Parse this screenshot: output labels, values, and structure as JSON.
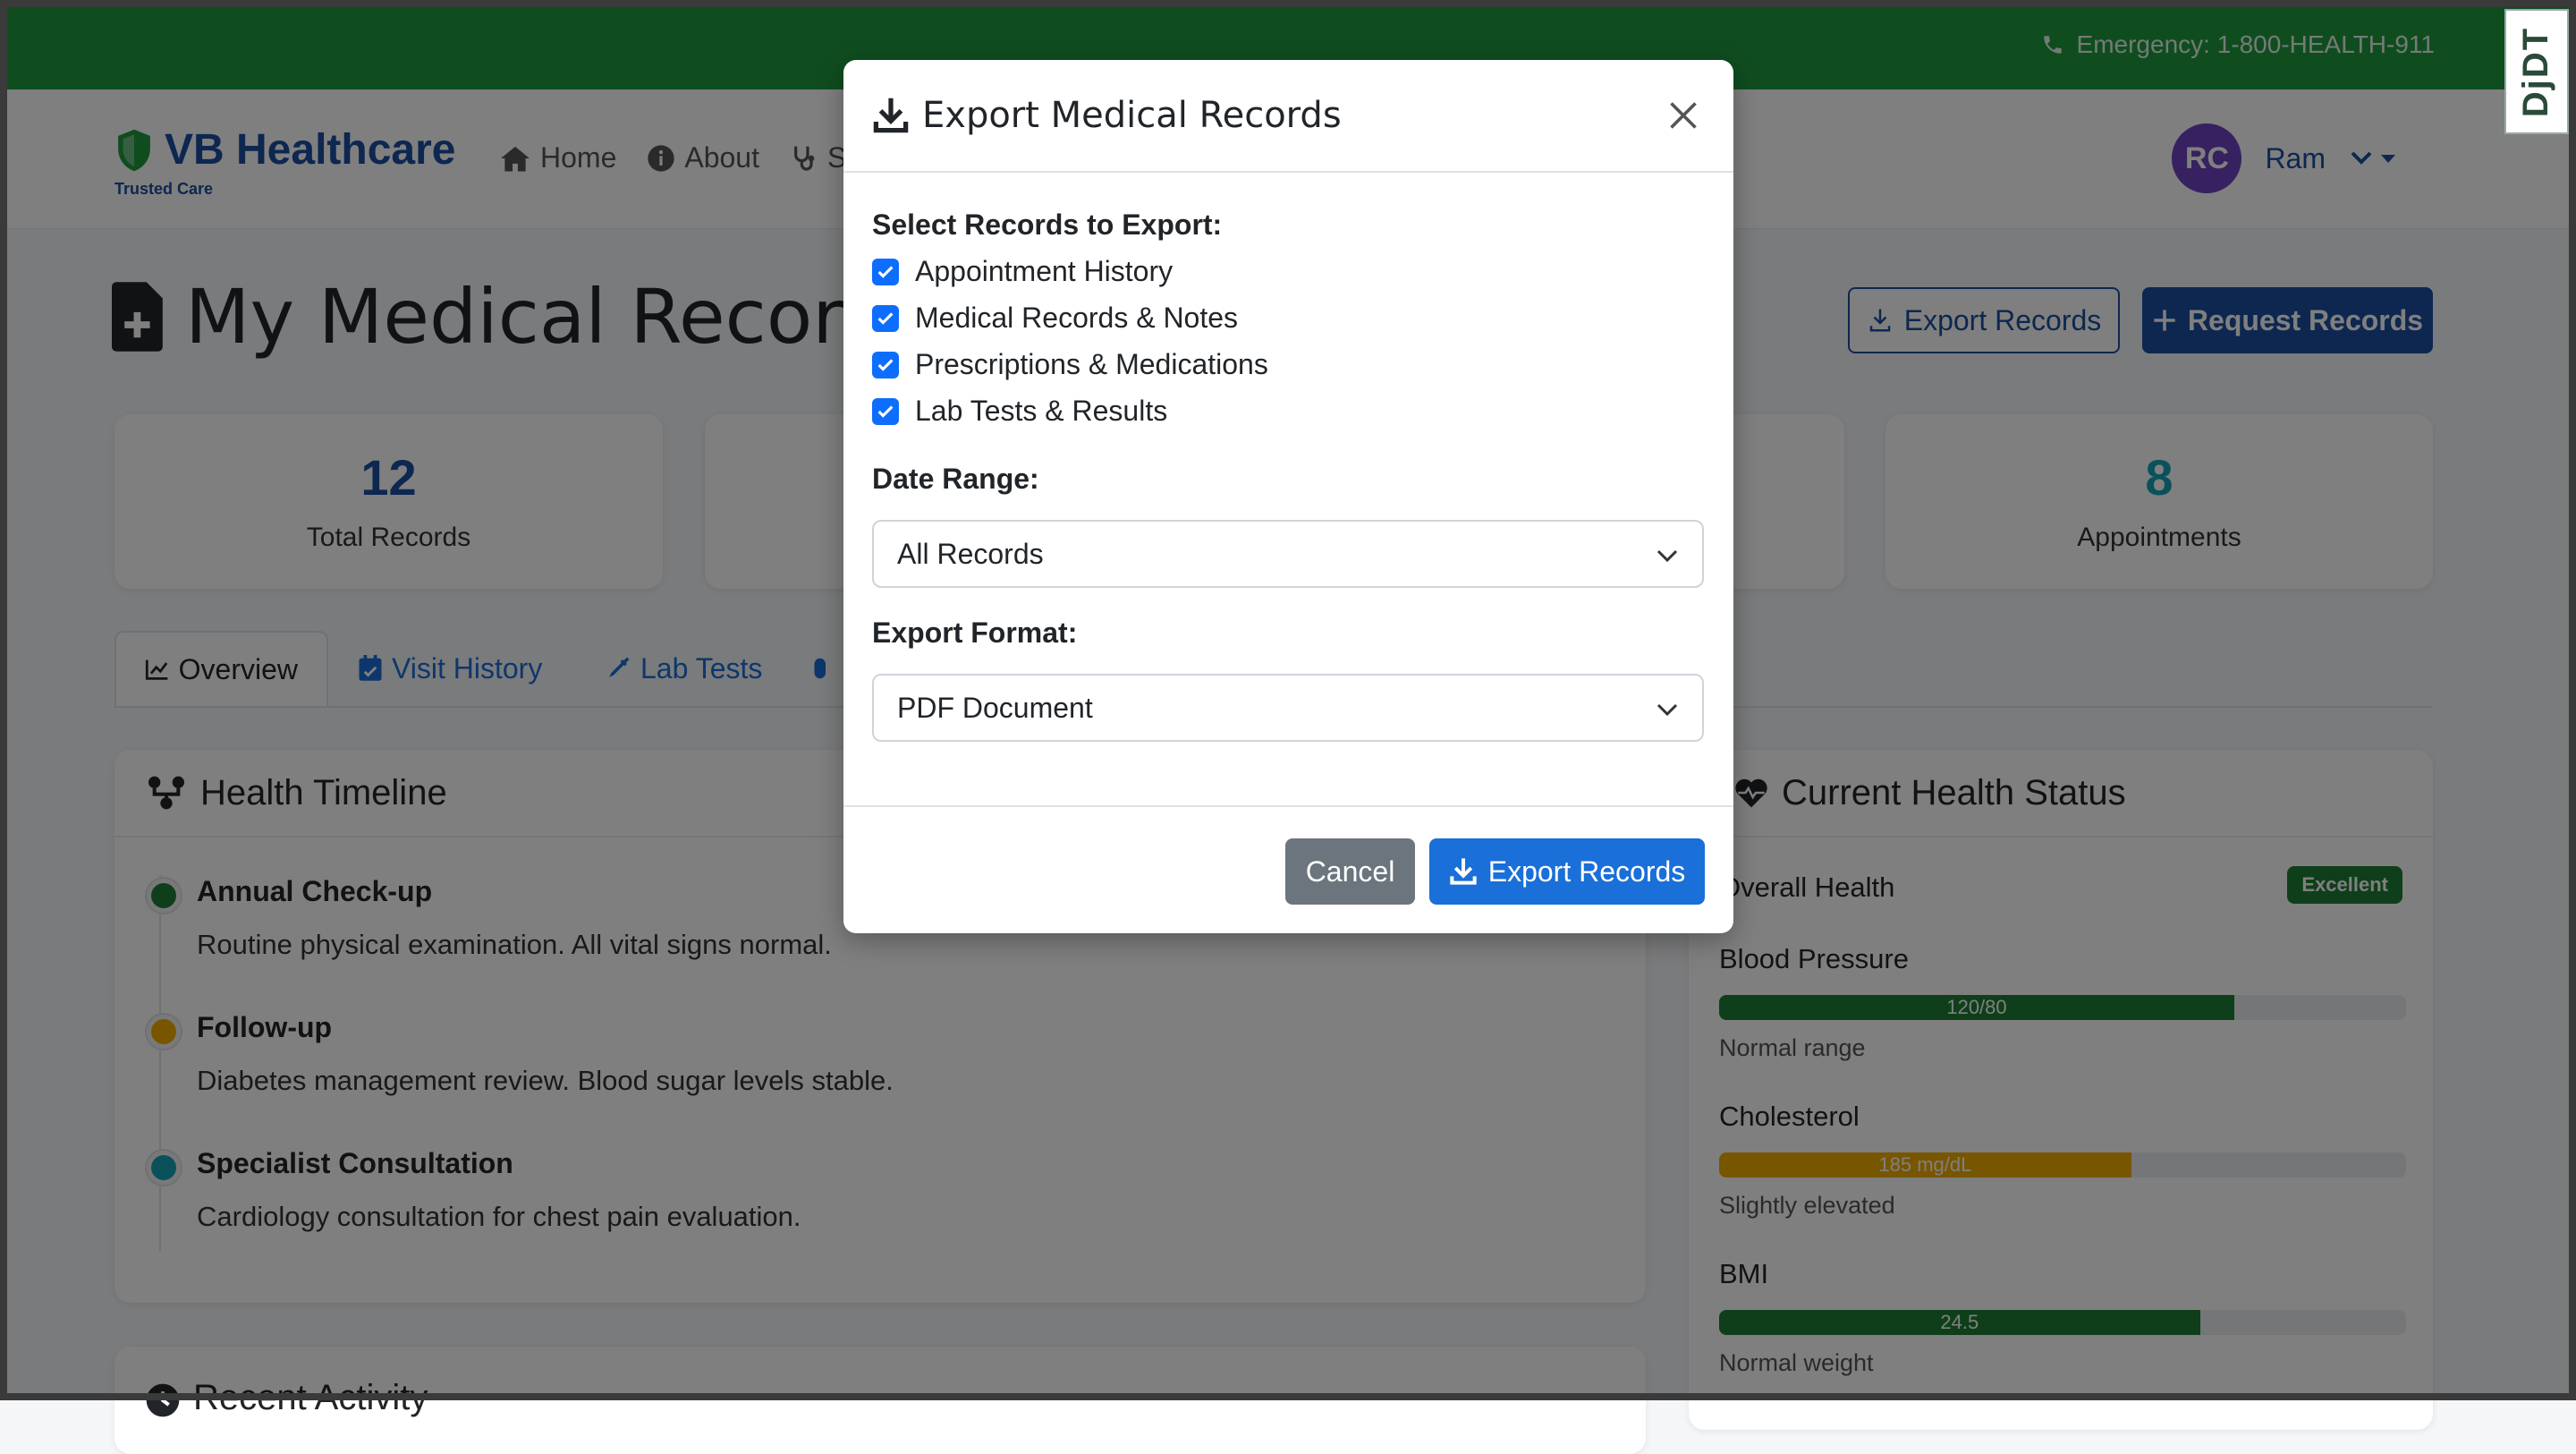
{
  "topbar": {
    "emergency": "Emergency: 1-800-HEALTH-911",
    "djdt": "DjDT"
  },
  "navbar": {
    "brand_name": "VB Healthcare",
    "brand_tagline": "Trusted Care",
    "links": [
      "Home",
      "About",
      "S"
    ],
    "user_initials": "RC",
    "user_name": "Ram"
  },
  "page": {
    "title": "My Medical Records",
    "export_button": "Export Records",
    "request_button": "Request Records"
  },
  "stats": [
    {
      "value": "12",
      "label": "Total Records",
      "color": "#1a4fa0"
    },
    {
      "value": "8",
      "label": "Appointments",
      "color": "#17a2b8"
    }
  ],
  "tabs": [
    "Overview",
    "Visit History",
    "Lab Tests"
  ],
  "timeline": {
    "title": "Health Timeline",
    "items": [
      {
        "title": "Annual Check-up",
        "desc": "Routine physical examination. All vital signs normal.",
        "color": "#1e7e34"
      },
      {
        "title": "Follow-up",
        "desc": "Diabetes management review. Blood sugar levels stable.",
        "color": "#f0ad00"
      },
      {
        "title": "Specialist Consultation",
        "desc": "Cardiology consultation for chest pain evaluation.",
        "color": "#17a2b8"
      }
    ]
  },
  "health_status": {
    "title": "Current Health Status",
    "overall_label": "Overall Health",
    "overall_badge": "Excellent",
    "metrics": [
      {
        "label": "Blood Pressure",
        "value": "120/80",
        "note": "Normal range",
        "fill": 0.75,
        "color": "#1e7e34"
      },
      {
        "label": "Cholesterol",
        "value": "185 mg/dL",
        "note": "Slightly elevated",
        "fill": 0.6,
        "color": "#f0ad00"
      },
      {
        "label": "BMI",
        "value": "24.5",
        "note": "Normal weight",
        "fill": 0.7,
        "color": "#1e7e34"
      }
    ]
  },
  "recent_activity": {
    "title": "Recent Activity"
  },
  "modal": {
    "title": "Export Medical Records",
    "select_label": "Select Records to Export:",
    "options": [
      "Appointment History",
      "Medical Records & Notes",
      "Prescriptions & Medications",
      "Lab Tests & Results"
    ],
    "date_range_label": "Date Range:",
    "date_range_value": "All Records",
    "format_label": "Export Format:",
    "format_value": "PDF Document",
    "cancel": "Cancel",
    "export": "Export Records"
  }
}
